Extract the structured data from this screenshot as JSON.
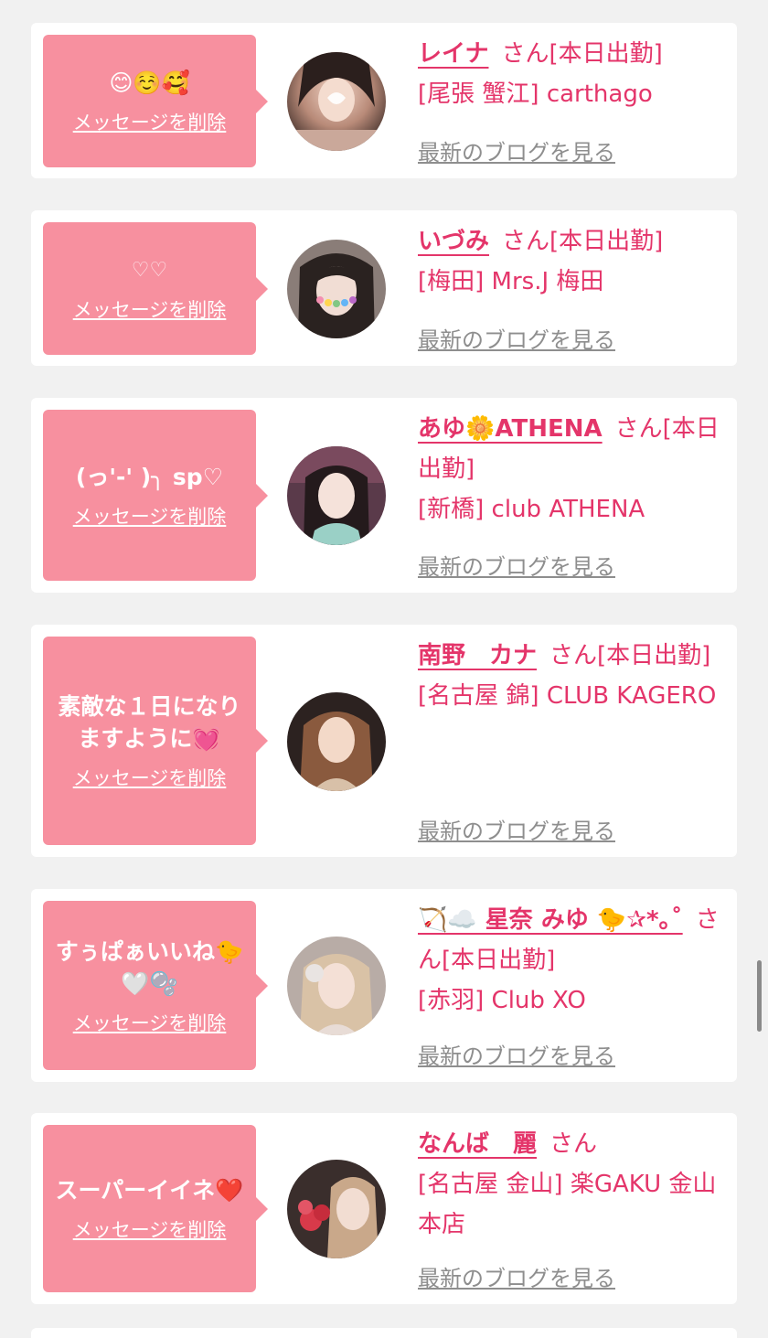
{
  "common": {
    "delete_label": "メッセージを削除",
    "blog_label": "最新のブログを見る"
  },
  "cards": [
    {
      "message": "😊☺️🥰",
      "name": "レイナ",
      "san": "さん[本日出勤]",
      "shop": "[尾張 蟹江] carthago"
    },
    {
      "message": "♡♡",
      "name": "いづみ",
      "san": "さん[本日出勤]",
      "shop": "[梅田] Mrs.J 梅田"
    },
    {
      "message": "(っ'-' )╮ sp♡",
      "name": "あゆ🌼ATHENA",
      "san": "さん[本日出勤]",
      "shop": "[新橋] club ATHENA"
    },
    {
      "message": "素敵な１日になりますように💓",
      "name": "南野　カナ",
      "san": "さん[本日出勤]",
      "shop": "[名古屋 錦] CLUB KAGERO"
    },
    {
      "message": "すぅぱぁいいね🐤🤍🫧",
      "name": "🏹☁️ 星奈 みゆ 🐤✰*｡˚",
      "san": "さん[本日出勤]",
      "shop": "[赤羽] Club XO"
    },
    {
      "message": "スーパーイイネ❤️",
      "name": "なんば　麗",
      "san": "さん",
      "shop": "[名古屋 金山] 楽GAKU 金山本店"
    }
  ],
  "colors": {
    "accent": "#e4356a",
    "bubble": "#f7909f",
    "link_gray": "#8e8e8e",
    "background": "#f1f1f1"
  }
}
